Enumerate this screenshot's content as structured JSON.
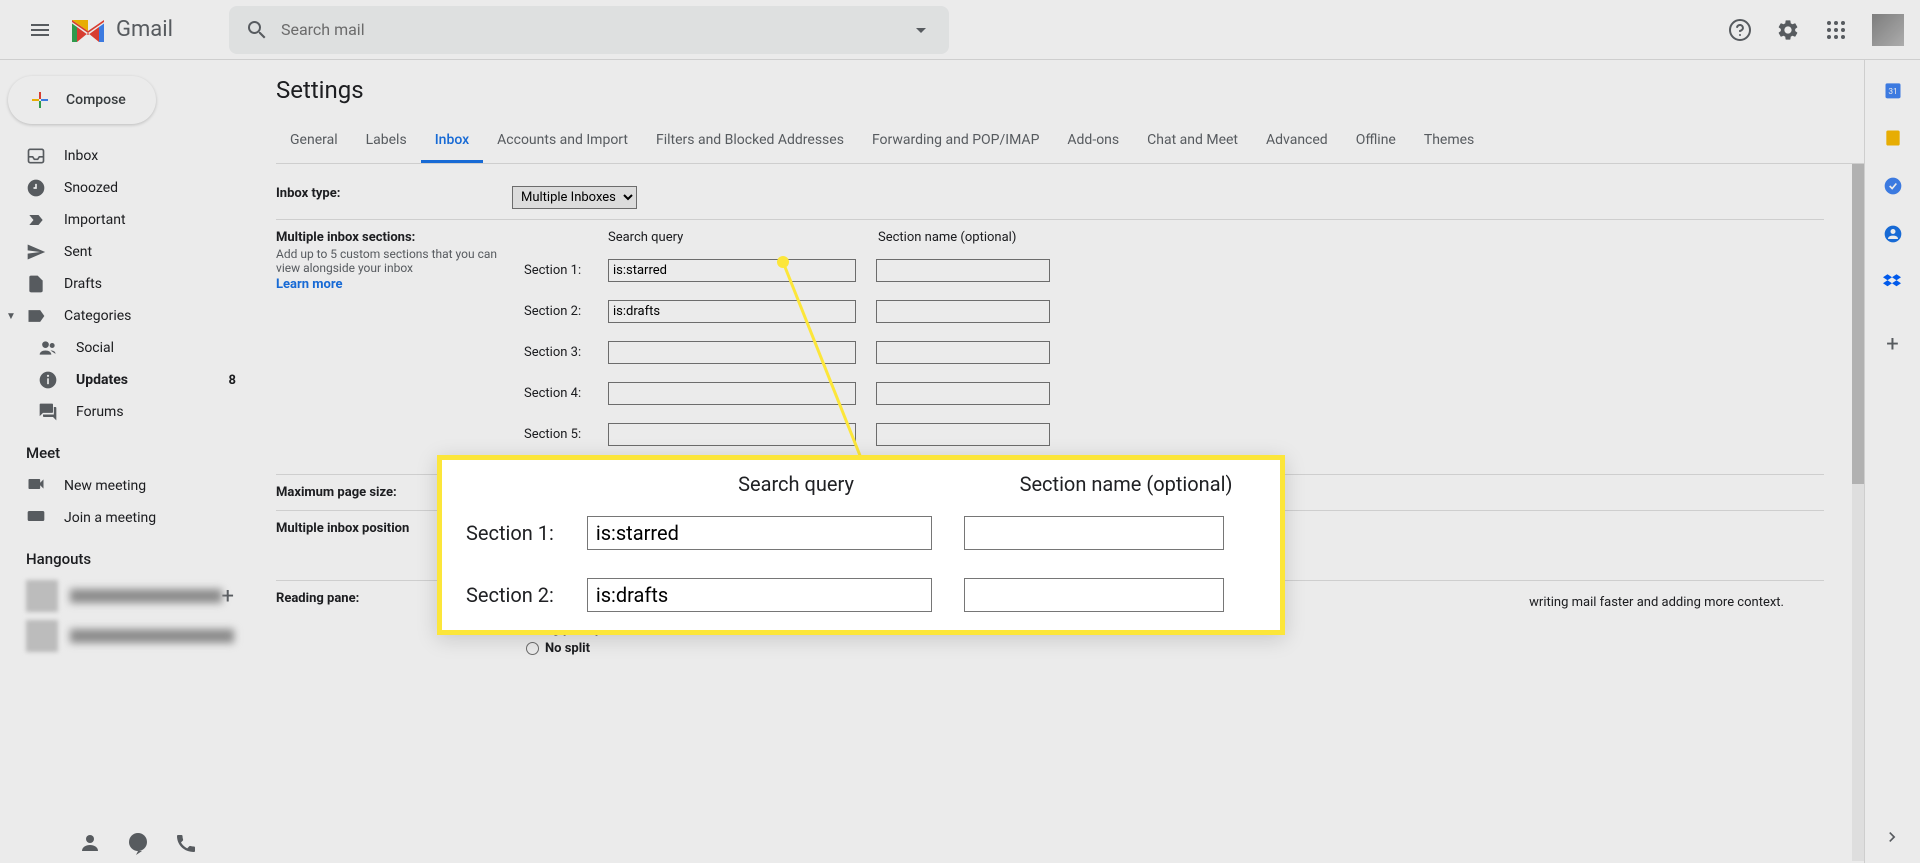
{
  "header": {
    "product_name": "Gmail",
    "search_placeholder": "Search mail"
  },
  "compose": {
    "label": "Compose"
  },
  "nav": {
    "inbox": "Inbox",
    "snoozed": "Snoozed",
    "important": "Important",
    "sent": "Sent",
    "drafts": "Drafts",
    "categories": "Categories",
    "social": "Social",
    "updates": "Updates",
    "updates_count": "8",
    "forums": "Forums"
  },
  "meet": {
    "title": "Meet",
    "new_meeting": "New meeting",
    "join_meeting": "Join a meeting"
  },
  "hangouts": {
    "title": "Hangouts"
  },
  "settings": {
    "title": "Settings",
    "tabs": {
      "general": "General",
      "labels": "Labels",
      "inbox": "Inbox",
      "accounts": "Accounts and Import",
      "filters": "Filters and Blocked Addresses",
      "forwarding": "Forwarding and POP/IMAP",
      "addons": "Add-ons",
      "chat": "Chat and Meet",
      "advanced": "Advanced",
      "offline": "Offline",
      "themes": "Themes"
    },
    "inbox_type": {
      "label": "Inbox type:",
      "value": "Multiple Inboxes"
    },
    "multiple_sections": {
      "label": "Multiple inbox sections:",
      "sublabel": "Add up to 5 custom sections that you can view alongside your inbox",
      "learn_more": "Learn more",
      "header_query": "Search query",
      "header_name": "Section name (optional)",
      "rows": [
        {
          "label": "Section 1:",
          "query": "is:starred",
          "name": ""
        },
        {
          "label": "Section 2:",
          "query": "is:drafts",
          "name": ""
        },
        {
          "label": "Section 3:",
          "query": "",
          "name": ""
        },
        {
          "label": "Section 4:",
          "query": "",
          "name": ""
        },
        {
          "label": "Section 5:",
          "query": "",
          "name": ""
        }
      ]
    },
    "max_page_size": {
      "label": "Maximum page size:"
    },
    "multiple_inbox_position": {
      "label": "Multiple inbox position"
    },
    "reading_pane": {
      "label": "Reading pane:",
      "text_suffix": "writing mail faster and adding more context.",
      "position_label": "Reading pane position",
      "no_split": "No split"
    }
  },
  "callout": {
    "header_query": "Search query",
    "header_name": "Section name (optional)",
    "rows": [
      {
        "label": "Section 1:",
        "query": "is:starred",
        "name": ""
      },
      {
        "label": "Section 2:",
        "query": "is:drafts",
        "name": ""
      }
    ]
  }
}
